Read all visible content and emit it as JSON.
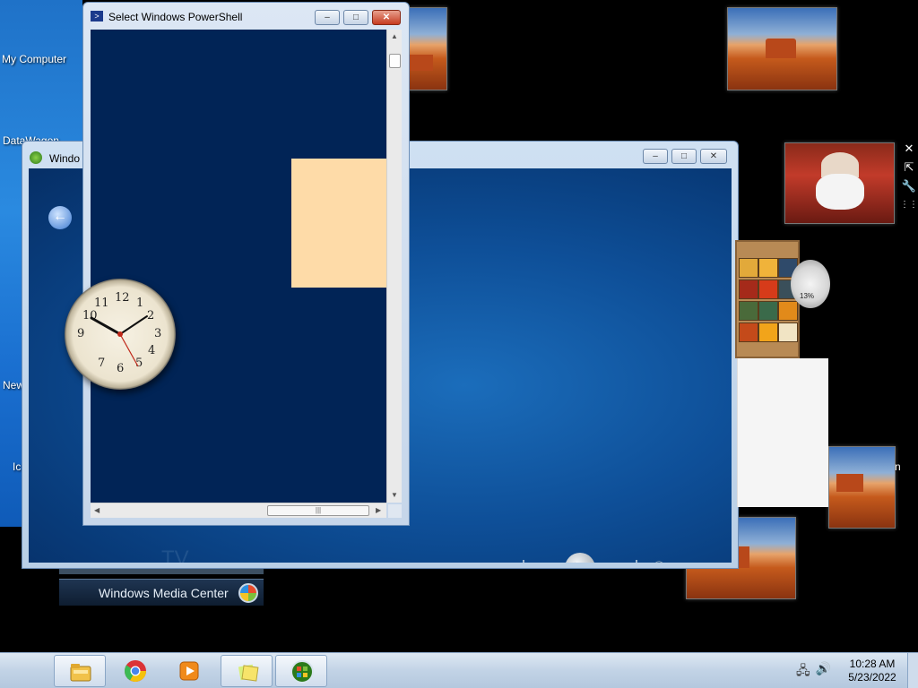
{
  "desktop": {
    "icons": [
      {
        "label": "My Computer"
      },
      {
        "label": "DataWagon"
      },
      {
        "label": "New"
      },
      {
        "label": "Ic"
      }
    ],
    "photo_label_partial": "n"
  },
  "media_center_window": {
    "title": "Windo",
    "back_symbol": "←",
    "tv_label": "TV",
    "buttons": {
      "minimize": "–",
      "maximize": "□",
      "close": "✕"
    },
    "transport": {
      "stop": "■",
      "rewind": "◀◀",
      "play": "▶",
      "fast_forward": "▶▶",
      "volume": "🔊",
      "minus": "−",
      "plus": "+"
    }
  },
  "media_center_strip": {
    "label": "Windows Media Center"
  },
  "powershell_window": {
    "title": "Select Windows PowerShell",
    "icon_glyph": ">",
    "buttons": {
      "minimize": "–",
      "maximize": "□",
      "close": "✕"
    },
    "scroll_grip": "|||",
    "rect_color": "#fedba8",
    "background_color": "#012456"
  },
  "clock_gadget": {
    "numbers": [
      "12",
      "1",
      "2",
      "3",
      "4",
      "5",
      "6",
      "7",
      "8",
      "9",
      "10",
      "11"
    ]
  },
  "gadget_controls": {
    "close": "✕",
    "size": "⇱",
    "options": "🔧",
    "drag": "⋮⋮"
  },
  "meter_gadget": {
    "value": "13%"
  },
  "taskbar": {
    "items": [
      {
        "name": "Windows Explorer",
        "icon": "folder-icon"
      },
      {
        "name": "Google Chrome",
        "icon": "chrome-icon"
      },
      {
        "name": "Windows Media Player",
        "icon": "media-player-icon"
      },
      {
        "name": "Sticky Notes",
        "icon": "sticky-notes-icon"
      },
      {
        "name": "Windows Media Center",
        "icon": "media-center-icon"
      }
    ],
    "time": "10:28 AM",
    "date": "5/23/2022"
  }
}
